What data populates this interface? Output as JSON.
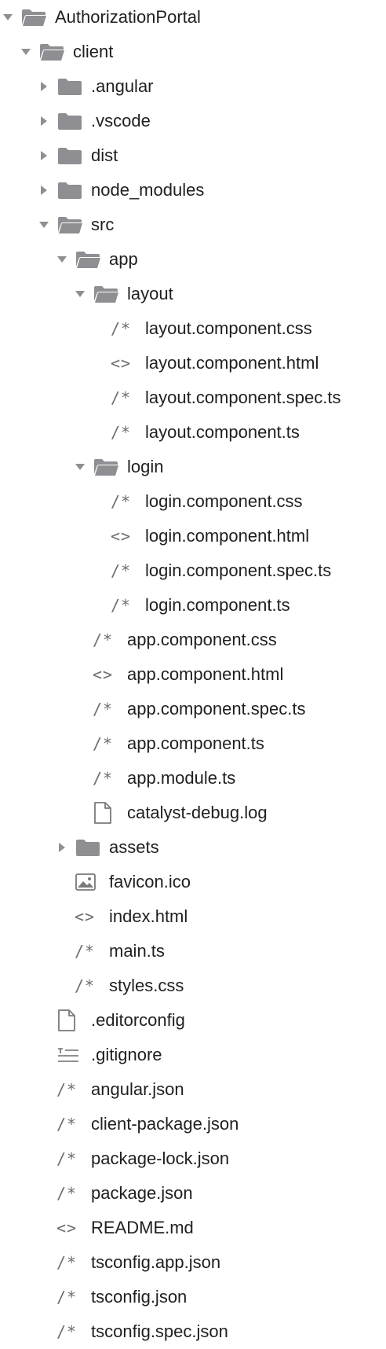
{
  "colors": {
    "folder": "#8e8e93",
    "chevron": "#8e8e93",
    "glyph": "#6d6d6d",
    "text": "#1f1f1f"
  },
  "tree": [
    {
      "label": "AuthorizationPortal",
      "depth": 0,
      "kind": "folder",
      "expanded": true,
      "icon": "folder-open-icon"
    },
    {
      "label": "client",
      "depth": 1,
      "kind": "folder",
      "expanded": true,
      "icon": "folder-open-icon"
    },
    {
      "label": ".angular",
      "depth": 2,
      "kind": "folder",
      "expanded": false,
      "icon": "folder-icon"
    },
    {
      "label": ".vscode",
      "depth": 2,
      "kind": "folder",
      "expanded": false,
      "icon": "folder-icon"
    },
    {
      "label": "dist",
      "depth": 2,
      "kind": "folder",
      "expanded": false,
      "icon": "folder-icon"
    },
    {
      "label": "node_modules",
      "depth": 2,
      "kind": "folder",
      "expanded": false,
      "icon": "folder-icon"
    },
    {
      "label": "src",
      "depth": 2,
      "kind": "folder",
      "expanded": true,
      "icon": "folder-open-icon"
    },
    {
      "label": "app",
      "depth": 3,
      "kind": "folder",
      "expanded": true,
      "icon": "folder-open-icon"
    },
    {
      "label": "layout",
      "depth": 4,
      "kind": "folder",
      "expanded": true,
      "icon": "folder-open-icon"
    },
    {
      "label": "layout.component.css",
      "depth": 5,
      "kind": "file",
      "glyph": "/*",
      "icon": "comment-file-icon"
    },
    {
      "label": "layout.component.html",
      "depth": 5,
      "kind": "file",
      "glyph": "<>",
      "icon": "code-file-icon"
    },
    {
      "label": "layout.component.spec.ts",
      "depth": 5,
      "kind": "file",
      "glyph": "/*",
      "icon": "comment-file-icon"
    },
    {
      "label": "layout.component.ts",
      "depth": 5,
      "kind": "file",
      "glyph": "/*",
      "icon": "comment-file-icon"
    },
    {
      "label": "login",
      "depth": 4,
      "kind": "folder",
      "expanded": true,
      "icon": "folder-open-icon"
    },
    {
      "label": "login.component.css",
      "depth": 5,
      "kind": "file",
      "glyph": "/*",
      "icon": "comment-file-icon"
    },
    {
      "label": "login.component.html",
      "depth": 5,
      "kind": "file",
      "glyph": "<>",
      "icon": "code-file-icon"
    },
    {
      "label": "login.component.spec.ts",
      "depth": 5,
      "kind": "file",
      "glyph": "/*",
      "icon": "comment-file-icon"
    },
    {
      "label": "login.component.ts",
      "depth": 5,
      "kind": "file",
      "glyph": "/*",
      "icon": "comment-file-icon"
    },
    {
      "label": "app.component.css",
      "depth": 4,
      "kind": "file",
      "glyph": "/*",
      "icon": "comment-file-icon"
    },
    {
      "label": "app.component.html",
      "depth": 4,
      "kind": "file",
      "glyph": "<>",
      "icon": "code-file-icon"
    },
    {
      "label": "app.component.spec.ts",
      "depth": 4,
      "kind": "file",
      "glyph": "/*",
      "icon": "comment-file-icon"
    },
    {
      "label": "app.component.ts",
      "depth": 4,
      "kind": "file",
      "glyph": "/*",
      "icon": "comment-file-icon"
    },
    {
      "label": "app.module.ts",
      "depth": 4,
      "kind": "file",
      "glyph": "/*",
      "icon": "comment-file-icon"
    },
    {
      "label": "catalyst-debug.log",
      "depth": 4,
      "kind": "file",
      "glyph": "",
      "icon": "document-icon"
    },
    {
      "label": "assets",
      "depth": 3,
      "kind": "folder",
      "expanded": false,
      "icon": "folder-icon"
    },
    {
      "label": "favicon.ico",
      "depth": 3,
      "kind": "file",
      "glyph": "",
      "icon": "image-icon"
    },
    {
      "label": "index.html",
      "depth": 3,
      "kind": "file",
      "glyph": "<>",
      "icon": "code-file-icon"
    },
    {
      "label": "main.ts",
      "depth": 3,
      "kind": "file",
      "glyph": "/*",
      "icon": "comment-file-icon"
    },
    {
      "label": "styles.css",
      "depth": 3,
      "kind": "file",
      "glyph": "/*",
      "icon": "comment-file-icon"
    },
    {
      "label": ".editorconfig",
      "depth": 2,
      "kind": "file",
      "glyph": "",
      "icon": "document-icon"
    },
    {
      "label": ".gitignore",
      "depth": 2,
      "kind": "file",
      "glyph": "",
      "icon": "text-lines-icon"
    },
    {
      "label": "angular.json",
      "depth": 2,
      "kind": "file",
      "glyph": "/*",
      "icon": "comment-file-icon"
    },
    {
      "label": "client-package.json",
      "depth": 2,
      "kind": "file",
      "glyph": "/*",
      "icon": "comment-file-icon"
    },
    {
      "label": "package-lock.json",
      "depth": 2,
      "kind": "file",
      "glyph": "/*",
      "icon": "comment-file-icon"
    },
    {
      "label": "package.json",
      "depth": 2,
      "kind": "file",
      "glyph": "/*",
      "icon": "comment-file-icon"
    },
    {
      "label": "README.md",
      "depth": 2,
      "kind": "file",
      "glyph": "<>",
      "icon": "code-file-icon"
    },
    {
      "label": "tsconfig.app.json",
      "depth": 2,
      "kind": "file",
      "glyph": "/*",
      "icon": "comment-file-icon"
    },
    {
      "label": "tsconfig.json",
      "depth": 2,
      "kind": "file",
      "glyph": "/*",
      "icon": "comment-file-icon"
    },
    {
      "label": "tsconfig.spec.json",
      "depth": 2,
      "kind": "file",
      "glyph": "/*",
      "icon": "comment-file-icon"
    }
  ]
}
